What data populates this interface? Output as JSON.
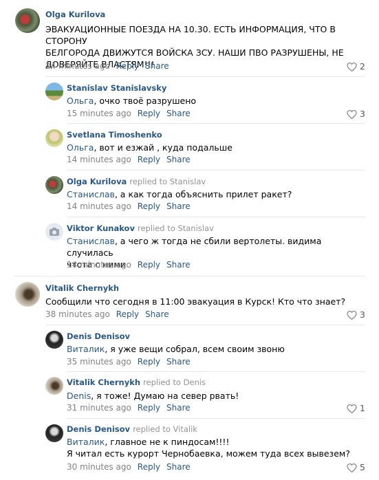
{
  "comments": [
    {
      "author": "Olga Kurilova",
      "replied": "",
      "addr": "",
      "text1": "ЭВАКУАЦИОННЫЕ ПОЕЗДА НА 10.30. ЕСТЬ ИНФОРМАЦИЯ, ЧТО В СТОРОНУ",
      "text2": "БЕЛГОРОДА ДВИЖУТСЯ ВОЙСКА ЗСУ. НАШИ ПВО РАЗРУШЕНЫ, НЕ",
      "text3": "ДОВЕРЯЙТЕ ВЛАСТЯМ!!!",
      "time": "24 minutes ago",
      "reply": "Reply",
      "share": "Share",
      "likes": "2"
    },
    {
      "author": "Stanislav Stanislavsky",
      "replied": "",
      "addr": "Ольга",
      "text1": ", очко твоё разрушено",
      "time": "15 minutes ago",
      "reply": "Reply",
      "share": "Share",
      "likes": "3"
    },
    {
      "author": "Svetlana Timoshenko",
      "replied": "",
      "addr": "Ольга",
      "text1": ", вот и езжай , куда подальше",
      "time": "14 minutes ago",
      "reply": "Reply",
      "share": "Share",
      "likes": ""
    },
    {
      "author": "Olga Kurilova",
      "replied": "replied to Stanislav",
      "addr": "Станислав",
      "text1": ", а как тогда объяснить прилет ракет?",
      "time": "14 minutes ago",
      "reply": "Reply",
      "share": "Share",
      "likes": ""
    },
    {
      "author": "Viktor Kunakov",
      "replied": "replied to Stanislav",
      "addr": "Станислав",
      "text1": ", а чего ж тогда не сбили вертолеты. видима случилась",
      "text2": "чтота с ними",
      "time": "14 minutes ago",
      "reply": "Reply",
      "share": "Share",
      "likes": ""
    },
    {
      "author": "Vitalik Chernykh",
      "replied": "",
      "addr": "",
      "text1": "Сообщили что сегодня в 11:00 эвакуация в Курск! Кто что знает?",
      "time": "38 minutes ago",
      "reply": "Reply",
      "share": "Share",
      "likes": "3"
    },
    {
      "author": "Denis Denisov",
      "replied": "",
      "addr": "Виталик",
      "text1": ", я уже вещи собрал, всем своим звоню",
      "time": "35 minutes ago",
      "reply": "Reply",
      "share": "Share",
      "likes": ""
    },
    {
      "author": "Vitalik Chernykh",
      "replied": "replied to Denis",
      "addr": "Denis",
      "text1": ", я тоже! Думаю на север рвать!",
      "time": "31 minutes ago",
      "reply": "Reply",
      "share": "Share",
      "likes": "1"
    },
    {
      "author": "Denis Denisov",
      "replied": "replied to Vitalik",
      "addr": "Виталик",
      "text1": ", главное не к пиндосам!!!!",
      "text2": "Я читал есть курорт Чернобаевка, можем туда всех вывезем?",
      "time": "30 minutes ago",
      "reply": "Reply",
      "share": "Share",
      "likes": "5"
    }
  ]
}
